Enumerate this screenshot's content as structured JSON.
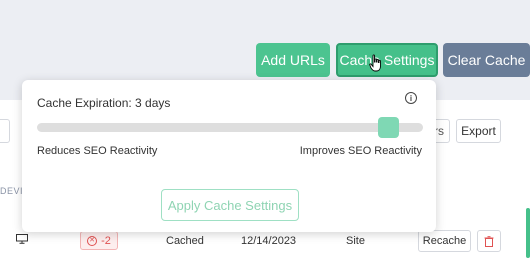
{
  "header": {
    "add_urls_label": "Add URLs",
    "cache_settings_label": "Cache Settings",
    "clear_cache_label": "Clear Cache"
  },
  "toolbar": {
    "filters_partial": "rs",
    "export_label": "Export"
  },
  "table": {
    "device_header_partial": "DEVI",
    "row": {
      "score": "-2",
      "status": "Cached",
      "date": "12/14/2023",
      "type": "Site",
      "recache_label": "Recache"
    }
  },
  "popover": {
    "title": "Cache Expiration: 3 days",
    "left_label": "Reduces SEO Reactivity",
    "right_label": "Improves SEO Reactivity",
    "apply_label": "Apply Cache Settings",
    "slider_fraction": 0.91
  },
  "colors": {
    "primary_green": "#45c08a",
    "slate": "#6a7d98",
    "danger": "#e05252"
  }
}
